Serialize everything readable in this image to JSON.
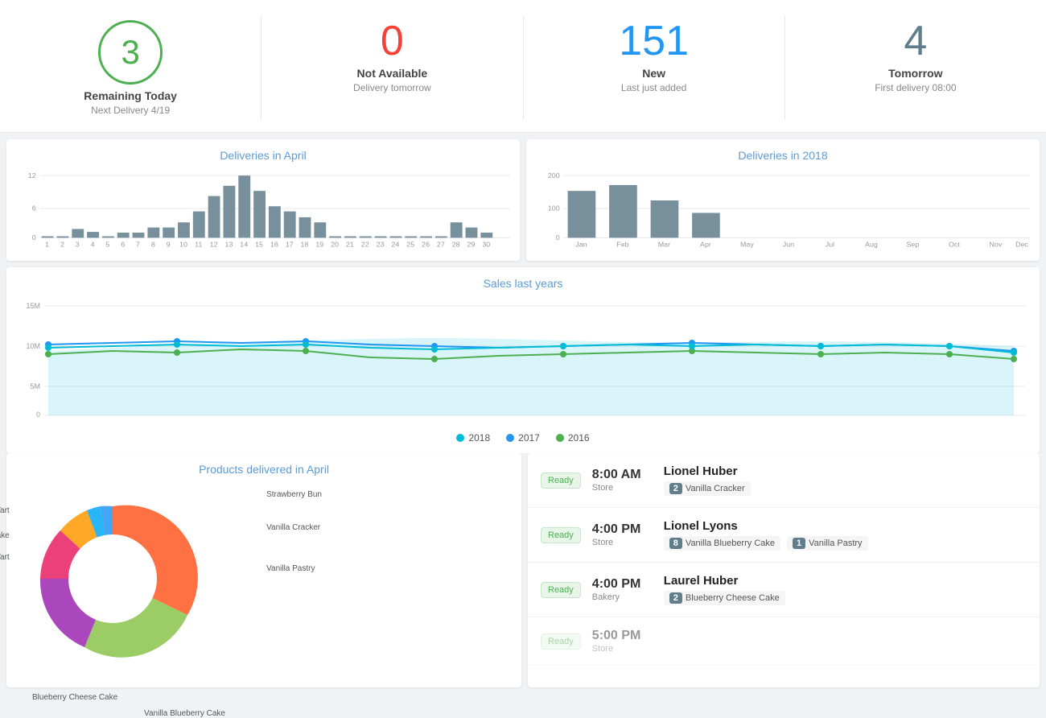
{
  "stats": [
    {
      "id": "remaining-today",
      "number": "3",
      "style": "circle-green",
      "label": "Remaining Today",
      "sublabel": "Next Delivery 4/19"
    },
    {
      "id": "not-available",
      "number": "0",
      "style": "red",
      "label": "Not Available",
      "sublabel": "Delivery tomorrow"
    },
    {
      "id": "new",
      "number": "151",
      "style": "blue",
      "label": "New",
      "sublabel": "Last just added"
    },
    {
      "id": "tomorrow",
      "number": "4",
      "style": "gray",
      "label": "Tomorrow",
      "sublabel": "First delivery 08:00"
    }
  ],
  "aprilChart": {
    "title": "Deliveries in April",
    "yMax": 12,
    "yMid": 6,
    "labels": [
      "1",
      "2",
      "3",
      "4",
      "5",
      "6",
      "7",
      "8",
      "9",
      "10",
      "11",
      "12",
      "13",
      "14",
      "15",
      "16",
      "17",
      "18",
      "19",
      "20",
      "21",
      "22",
      "23",
      "24",
      "25",
      "26",
      "27",
      "28",
      "29",
      "30"
    ],
    "values": [
      0.5,
      0.5,
      1.5,
      1,
      0.5,
      1,
      1,
      2,
      2,
      3,
      5,
      8,
      10,
      12,
      9,
      6,
      5,
      4,
      3,
      0,
      0,
      0,
      0,
      0.5,
      0.5,
      0,
      0,
      3,
      2,
      1
    ]
  },
  "annualChart": {
    "title": "Deliveries in 2018",
    "yMax": 200,
    "labels": [
      "Jan",
      "Feb",
      "Mar",
      "Apr",
      "May",
      "Jun",
      "Jul",
      "Aug",
      "Sep",
      "Oct",
      "Nov",
      "Dec"
    ],
    "values": [
      150,
      170,
      120,
      80,
      0,
      0,
      0,
      0,
      0,
      0,
      0,
      0
    ]
  },
  "salesChart": {
    "title": "Sales last years",
    "yLabels": [
      "15M",
      "10M",
      "5M",
      "0"
    ],
    "legend": [
      {
        "label": "2018",
        "color": "#00BCD4"
      },
      {
        "label": "2017",
        "color": "#2196F3"
      },
      {
        "label": "2016",
        "color": "#4CAF50"
      }
    ]
  },
  "donutChart": {
    "title": "Products delivered in April",
    "segments": [
      {
        "label": "Vanilla Pastry",
        "color": "#8BC34A",
        "pct": 22
      },
      {
        "label": "Vanilla Cracker",
        "color": "#212121",
        "pct": 8
      },
      {
        "label": "Strawberry Bun",
        "color": "#2196F3",
        "pct": 5
      },
      {
        "label": "Strawberry Tart",
        "color": "#03A9F4",
        "pct": 4
      },
      {
        "label": "Strawberry Cheese Cake",
        "color": "#FF9800",
        "pct": 7
      },
      {
        "label": "Raspberry Blueberry Tart",
        "color": "#E91E63",
        "pct": 10
      },
      {
        "label": "Blueberry Cheese Cake",
        "color": "#9C27B0",
        "pct": 18
      },
      {
        "label": "Vanilla Blueberry Cake",
        "color": "#FF5722",
        "pct": 26
      }
    ]
  },
  "deliveries": [
    {
      "status": "Ready",
      "time": "8:00 AM",
      "location": "Store",
      "name": "Lionel Huber",
      "items": [
        {
          "qty": 2,
          "name": "Vanilla Cracker"
        }
      ]
    },
    {
      "status": "Ready",
      "time": "4:00 PM",
      "location": "Store",
      "name": "Lionel Lyons",
      "items": [
        {
          "qty": 8,
          "name": "Vanilla Blueberry Cake"
        },
        {
          "qty": 1,
          "name": "Vanilla Pastry"
        }
      ]
    },
    {
      "status": "Ready",
      "time": "4:00 PM",
      "location": "Bakery",
      "name": "Laurel Huber",
      "items": [
        {
          "qty": 2,
          "name": "Blueberry Cheese Cake"
        }
      ]
    }
  ]
}
